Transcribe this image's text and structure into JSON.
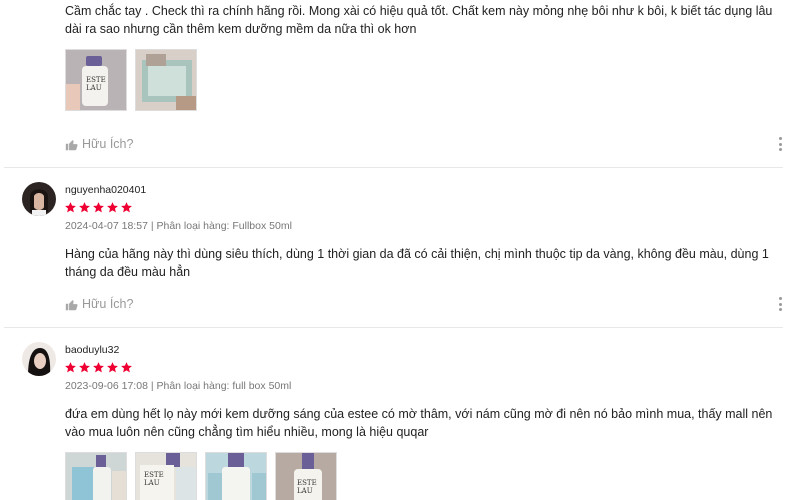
{
  "reviews": [
    {
      "text": "Cầm chắc tay . Check thì ra chính hãng rồi. Mong xài có hiệu quả tốt. Chất kem này mỏng nhẹ bôi như k bôi, k biết tác dụng lâu dài ra sao nhưng cần thêm kem dưỡng mềm da nữa thì ok hơn",
      "helpful_label": "Hữu Ích?"
    },
    {
      "username": "nguyenha020401",
      "rating": 5,
      "date": "2024-04-07 18:57",
      "variation": "Phân loại hàng: Fullbox 50ml",
      "text": "Hàng của hãng này thì dùng siêu thích, dùng 1 thời gian da đã có cải thiện, chị mình thuộc tip da vàng, không đều màu, dùng 1 tháng da đều màu hẳn",
      "helpful_label": "Hữu Ích?"
    },
    {
      "username": "baoduylu32",
      "rating": 5,
      "date": "2023-09-06 17:08",
      "variation": "Phân loại hàng: full box 50ml",
      "text": "đứa em dùng hết lọ này mới kem dưỡng sáng của estee có mờ thâm, với nám cũng mờ đi nên nó bảo mình mua, thấy mall nên vào mua luôn nên cũng chẳng tìm hiểu nhiều, mong là hiệu quqar"
    }
  ],
  "colors": {
    "star": "#ee0033",
    "muted": "#999999",
    "divider": "#e8e8e8"
  },
  "icons": {
    "helpful": "thumbs-up-icon",
    "more": "more-vertical-icon",
    "star": "star-icon"
  }
}
